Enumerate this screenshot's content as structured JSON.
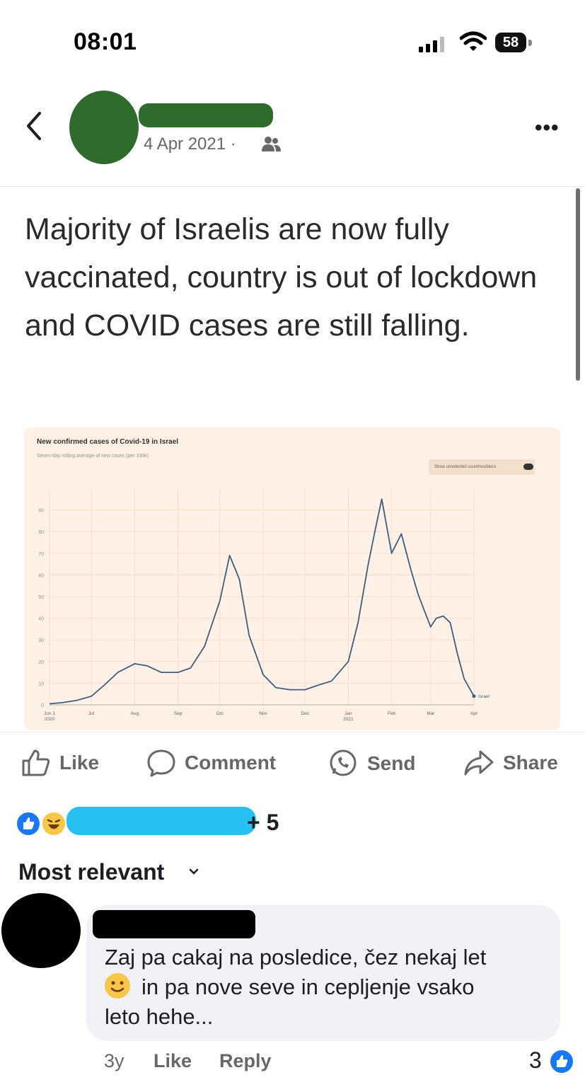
{
  "status_bar": {
    "time": "08:01",
    "battery": "58"
  },
  "post": {
    "date": "4 Apr 2021",
    "separator": "·",
    "audience_icon": "friends-icon",
    "text": "Majority of Israelis are now fully vaccinated, country is out of lockdown and COVID cases are still falling."
  },
  "chart_data": {
    "type": "line",
    "title": "New confirmed cases of Covid-19 in Israel",
    "subtitle": "Seven-day rolling average of new cases (per 100k)",
    "toggle_label": "Show unselected countries/blocs",
    "series": [
      {
        "name": "Israel",
        "x": [
          "2020-06-01",
          "2020-06-10",
          "2020-06-20",
          "2020-07-01",
          "2020-07-10",
          "2020-07-20",
          "2020-08-01",
          "2020-08-10",
          "2020-08-20",
          "2020-09-01",
          "2020-09-10",
          "2020-09-20",
          "2020-10-01",
          "2020-10-08",
          "2020-10-15",
          "2020-10-22",
          "2020-11-01",
          "2020-11-10",
          "2020-11-20",
          "2020-12-01",
          "2020-12-10",
          "2020-12-20",
          "2021-01-01",
          "2021-01-08",
          "2021-01-15",
          "2021-01-20",
          "2021-01-25",
          "2021-02-01",
          "2021-02-08",
          "2021-02-15",
          "2021-02-20",
          "2021-03-01",
          "2021-03-05",
          "2021-03-10",
          "2021-03-15",
          "2021-03-20",
          "2021-03-25",
          "2021-04-01"
        ],
        "values": [
          0.5,
          1,
          2,
          4,
          9,
          15,
          19,
          18,
          15,
          15,
          17,
          27,
          48,
          69,
          58,
          32,
          14,
          8,
          7,
          7,
          9,
          11,
          20,
          38,
          64,
          80,
          95,
          70,
          79,
          62,
          51,
          36,
          40,
          41,
          38,
          24,
          12,
          4
        ]
      }
    ],
    "x_ticks": [
      {
        "label": "Jun 1",
        "sub": "2020",
        "x": "2020-06-01"
      },
      {
        "label": "Jul",
        "sub": "",
        "x": "2020-07-01"
      },
      {
        "label": "Aug",
        "sub": "",
        "x": "2020-08-01"
      },
      {
        "label": "Sep",
        "sub": "",
        "x": "2020-09-01"
      },
      {
        "label": "Oct",
        "sub": "",
        "x": "2020-10-01"
      },
      {
        "label": "Nov",
        "sub": "",
        "x": "2020-11-01"
      },
      {
        "label": "Dec",
        "sub": "",
        "x": "2020-12-01"
      },
      {
        "label": "Jan",
        "sub": "2021",
        "x": "2021-01-01"
      },
      {
        "label": "Feb",
        "sub": "",
        "x": "2021-02-01"
      },
      {
        "label": "Mar",
        "sub": "",
        "x": "2021-03-01"
      },
      {
        "label": "Apr",
        "sub": "",
        "x": "2021-04-01"
      }
    ],
    "y_ticks": [
      0,
      10,
      20,
      30,
      40,
      50,
      60,
      70,
      80,
      90
    ],
    "ylim": [
      0,
      100
    ],
    "xlim": [
      "2020-06-01",
      "2021-04-01"
    ],
    "grid": true,
    "line_color": "#3f5d80",
    "background": "#fff1e5"
  },
  "actions": {
    "like": "Like",
    "comment": "Comment",
    "send": "Send",
    "share": "Share"
  },
  "reactions": {
    "count_label": "+ 5",
    "icons": [
      "like-icon",
      "haha-icon"
    ]
  },
  "comments": {
    "sort_label": "Most relevant",
    "items": [
      {
        "text_line1": "Zaj pa cakaj na posledice, čez nekaj let",
        "text_line2": "in pa nove seve in cepljenje vsako",
        "text_line3": "leto hehe...",
        "emoji": "slightly-smiling-emoji",
        "age": "3y",
        "like_label": "Like",
        "reply_label": "Reply",
        "reaction_count": "3"
      }
    ]
  },
  "colors": {
    "accent": "#1877f2",
    "muted": "#65676b",
    "bubble": "#f0f2f5"
  }
}
